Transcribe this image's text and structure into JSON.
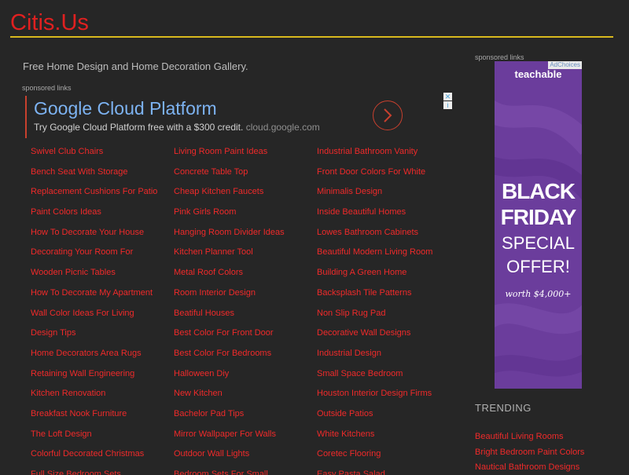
{
  "site": {
    "title": "Citis.Us"
  },
  "main": {
    "tagline": "Free Home Design and Home Decoration Gallery.",
    "sponsored_label": "sponsored links"
  },
  "ad": {
    "title": "Google Cloud Platform",
    "description": "Try Google Cloud Platform free with a $300 credit.",
    "url": "cloud.google.com",
    "close_glyph": "✕",
    "info_glyph": "i"
  },
  "links": [
    "Swivel Club Chairs",
    "Living Room Paint Ideas",
    "Industrial Bathroom Vanity",
    "Bench Seat With Storage",
    "Concrete Table Top",
    "Front Door Colors For White",
    "Replacement Cushions For Patio",
    "Cheap Kitchen Faucets",
    "Minimalis Design",
    "Paint Colors Ideas",
    "Pink Girls Room",
    "Inside Beautiful Homes",
    "How To Decorate Your House",
    "Hanging Room Divider Ideas",
    "Lowes Bathroom Cabinets",
    "Decorating Your Room For",
    "Kitchen Planner Tool",
    "Beautiful Modern Living Room",
    "Wooden Picnic Tables",
    "Metal Roof Colors",
    "Building A Green Home",
    "How To Decorate My Apartment",
    "Room Interior Design",
    "Backsplash Tile Patterns",
    "Wall Color Ideas For Living",
    "Beatiful Houses",
    "Non Slip Rug Pad",
    "Design Tips",
    "Best Color For Front Door",
    "Decorative Wall Designs",
    "Home Decorators Area Rugs",
    "Best Color For Bedrooms",
    "Industrial Design",
    "Retaining Wall Engineering",
    "Halloween Diy",
    "Small Space Bedroom",
    "Kitchen Renovation",
    "New Kitchen",
    "Houston Interior Design Firms",
    "Breakfast Nook Furniture",
    "Bachelor Pad Tips",
    "Outside Patios",
    "The Loft Design",
    "Mirror Wallpaper For Walls",
    "White Kitchens",
    "Colorful Decorated Christmas",
    "Outdoor Wall Lights",
    "Coretec Flooring",
    "Full Size Bedroom Sets",
    "Bedroom Sets For Small",
    "Easy Pasta Salad"
  ],
  "sidebar": {
    "sponsored_label": "sponsored links",
    "ad": {
      "adchoices": "AdChoices",
      "brand": "teachable",
      "line1": "BLACK",
      "line2": "FRIDAY",
      "line3": "SPECIAL",
      "line4": "OFFER!",
      "line5": "worth $4,000+",
      "background_color": "#6b3d9c"
    },
    "trending_title": "TRENDING",
    "trending": [
      "Beautiful Living Rooms",
      "Bright Bedroom Paint Colors",
      "Nautical Bathroom Designs"
    ]
  },
  "colors": {
    "background": "#262626",
    "brand_red": "#e02020",
    "link_red": "#f02a2a",
    "rule_gold": "#d9b91e",
    "ad_blue": "#7db3f2"
  }
}
